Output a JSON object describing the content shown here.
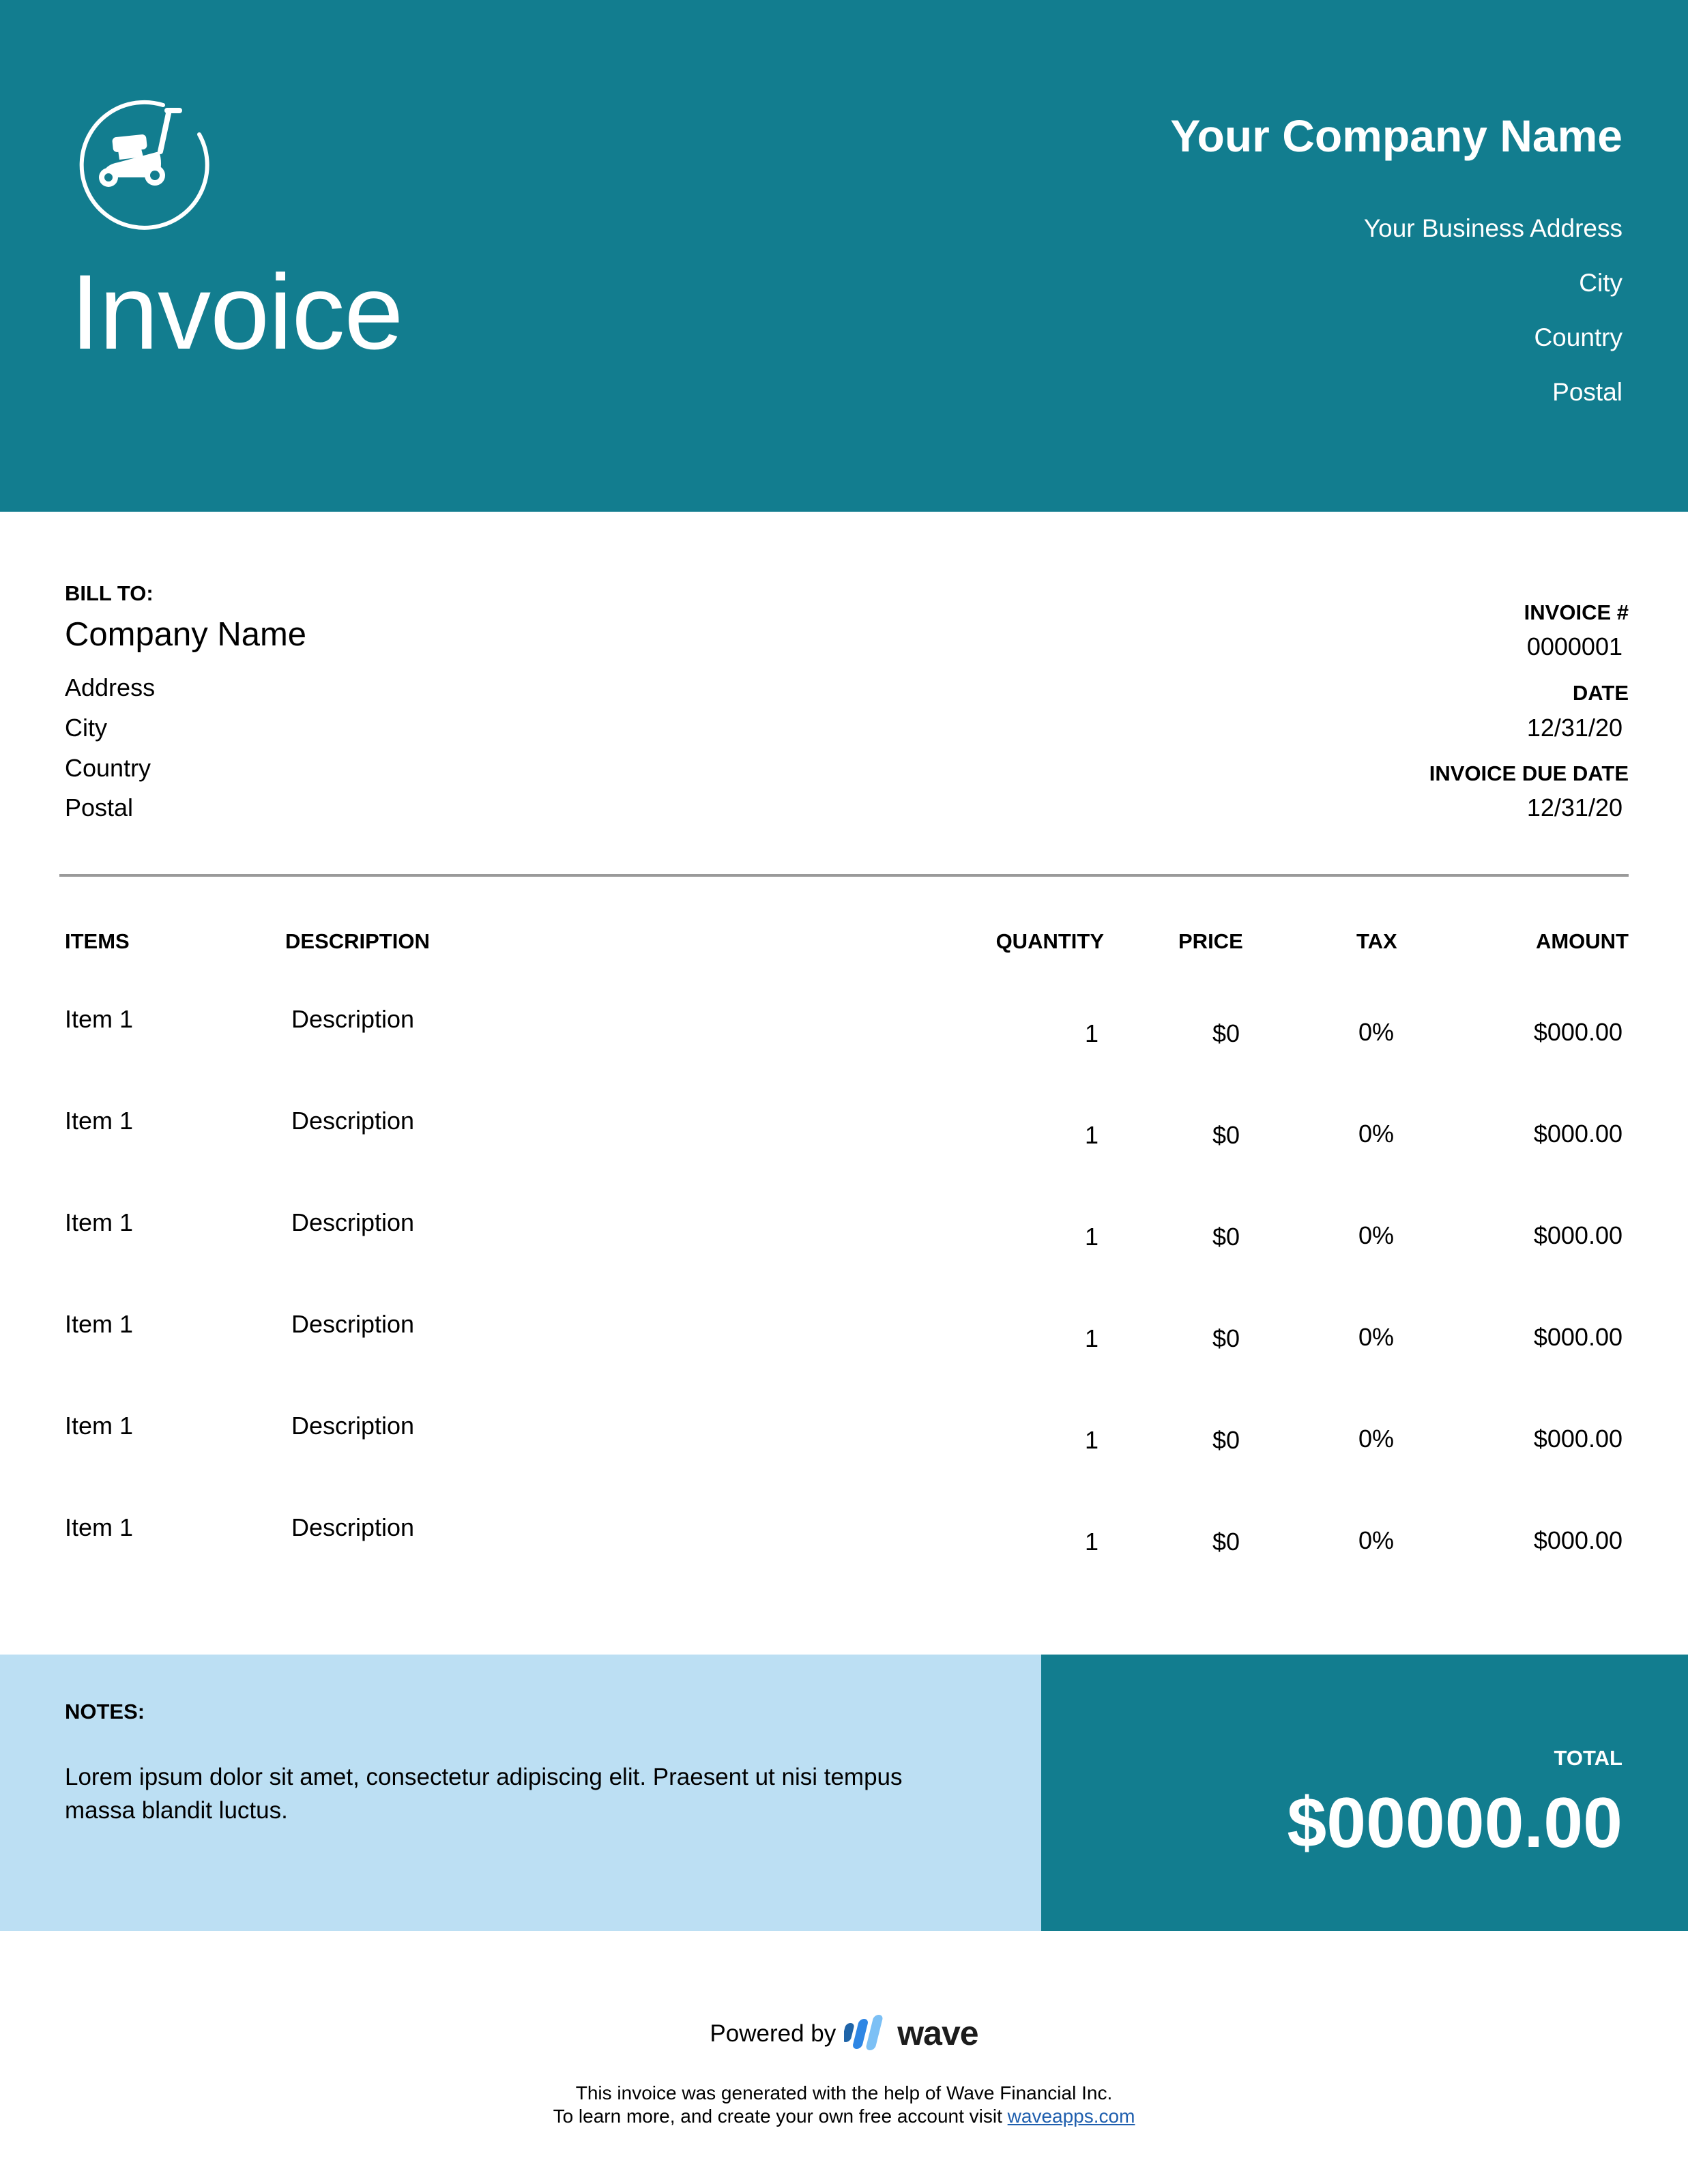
{
  "header": {
    "title": "Invoice",
    "logo_icon": "lawn-mower-icon",
    "company_name": "Your Company Name",
    "address_lines": [
      "Your Business Address",
      "City",
      "Country",
      "Postal"
    ]
  },
  "bill_to": {
    "label": "BILL TO:",
    "company": "Company Name",
    "lines": [
      "Address",
      "City",
      "Country",
      "Postal"
    ]
  },
  "meta": {
    "invoice_number_label": "INVOICE #",
    "invoice_number": "0000001",
    "date_label": "DATE",
    "date": "12/31/20",
    "due_date_label": "INVOICE DUE DATE",
    "due_date": "12/31/20"
  },
  "table": {
    "columns": [
      "ITEMS",
      "DESCRIPTION",
      "QUANTITY",
      "PRICE",
      "TAX",
      "AMOUNT"
    ],
    "rows": [
      {
        "item": "Item 1",
        "description": "Description",
        "quantity": "1",
        "price": "$0",
        "tax": "0%",
        "amount": "$000.00"
      },
      {
        "item": "Item 1",
        "description": "Description",
        "quantity": "1",
        "price": "$0",
        "tax": "0%",
        "amount": "$000.00"
      },
      {
        "item": "Item 1",
        "description": "Description",
        "quantity": "1",
        "price": "$0",
        "tax": "0%",
        "amount": "$000.00"
      },
      {
        "item": "Item 1",
        "description": "Description",
        "quantity": "1",
        "price": "$0",
        "tax": "0%",
        "amount": "$000.00"
      },
      {
        "item": "Item 1",
        "description": "Description",
        "quantity": "1",
        "price": "$0",
        "tax": "0%",
        "amount": "$000.00"
      },
      {
        "item": "Item 1",
        "description": "Description",
        "quantity": "1",
        "price": "$0",
        "tax": "0%",
        "amount": "$000.00"
      }
    ]
  },
  "notes": {
    "label": "NOTES:",
    "text": "Lorem ipsum dolor sit amet, consectetur adipiscing elit. Praesent ut nisi tempus massa blandit luctus."
  },
  "total": {
    "label": "TOTAL",
    "value": "$00000.00"
  },
  "footer": {
    "powered_by": "Powered by",
    "brand": "wave",
    "brand_icon": "wave-logo-icon",
    "line1": "This invoice was generated with the help of Wave Financial Inc.",
    "line2_prefix": "To learn more, and create your own free account visit ",
    "link_text": "waveapps.com"
  },
  "colors": {
    "accent": "#127D8F",
    "notes_bg": "#BCDFF3",
    "divider": "#9A9A9A",
    "link": "#1F5FAE"
  }
}
